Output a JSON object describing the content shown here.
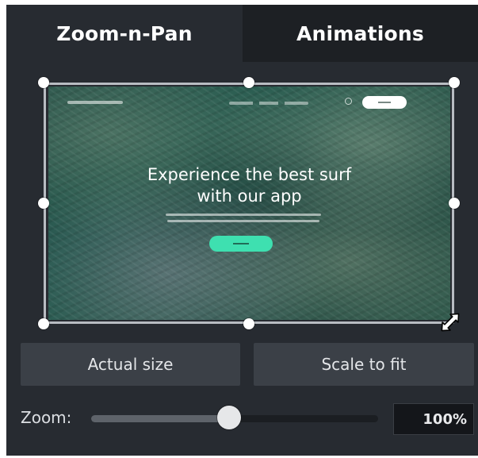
{
  "tabs": [
    {
      "label": "Zoom-n-Pan",
      "active": true
    },
    {
      "label": "Animations",
      "active": false
    }
  ],
  "preview": {
    "hero_title": "Experience the best surf\nwith our app"
  },
  "buttons": {
    "actual_size": "Actual size",
    "scale_to_fit": "Scale to fit"
  },
  "zoom": {
    "label": "Zoom:",
    "value": "100%",
    "slider_fraction": 0.48
  },
  "colors": {
    "panel_bg": "#272b31",
    "inactive_tab_bg": "#1d2024",
    "button_bg": "#3b4047",
    "hero_button": "#3ee0b0"
  },
  "icons": {
    "resize_cursor": "diagonal-resize-icon"
  }
}
